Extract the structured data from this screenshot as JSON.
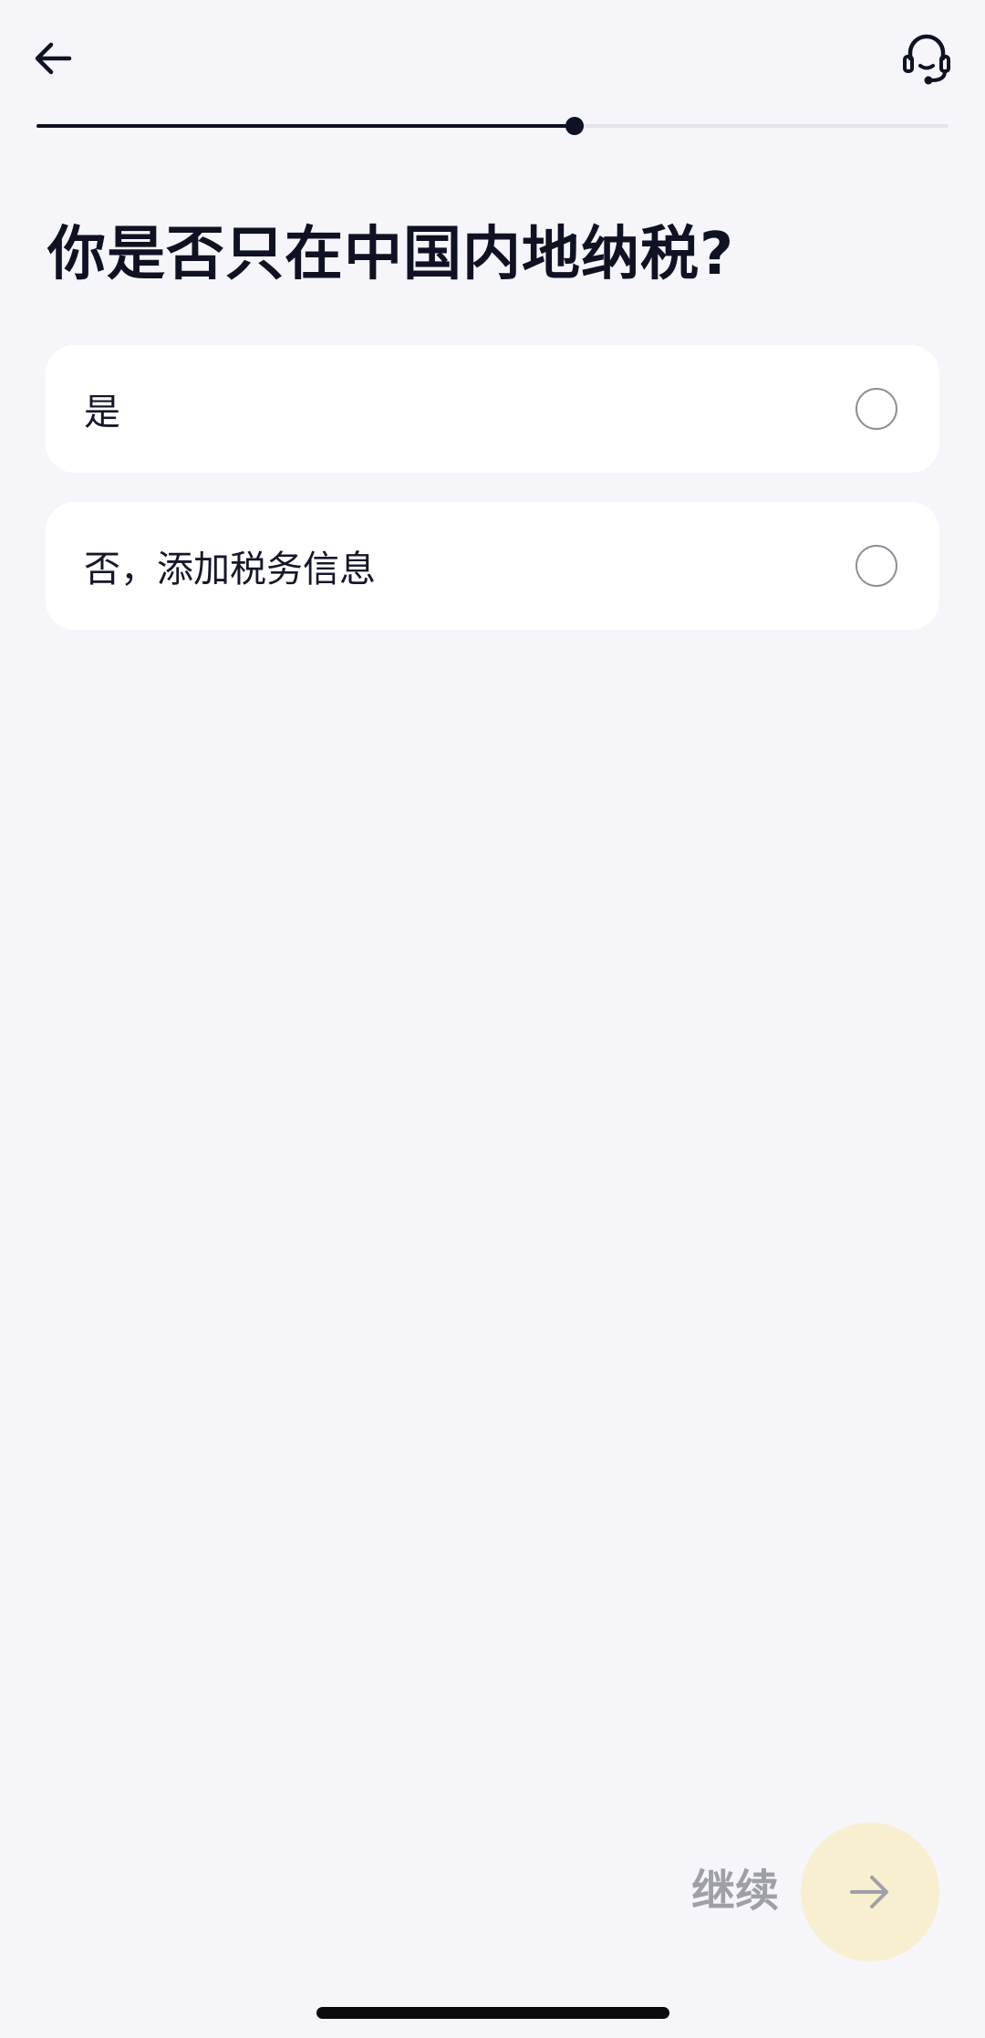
{
  "header": {
    "back_icon": "arrow-left-icon",
    "support_icon": "headset-icon"
  },
  "progress": {
    "fraction": 0.59
  },
  "question": {
    "title": "你是否只在中国内地纳税?"
  },
  "options": [
    {
      "label": "是",
      "selected": false
    },
    {
      "label": "否，添加税务信息",
      "selected": false
    }
  ],
  "footer": {
    "continue_label": "继续",
    "continue_icon": "arrow-right-icon",
    "accent_color": "#f7efcf"
  }
}
